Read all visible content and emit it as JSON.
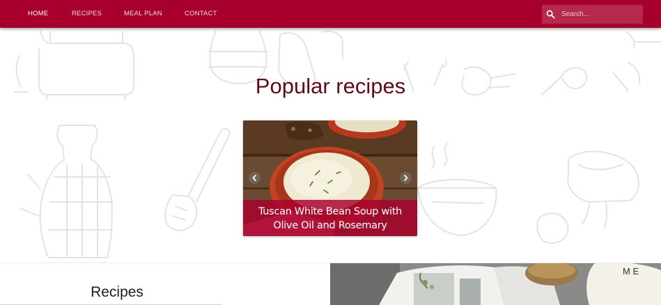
{
  "nav": {
    "links": [
      {
        "label": "HOME",
        "active": true
      },
      {
        "label": "RECIPES",
        "active": false
      },
      {
        "label": "MEAL PLAN",
        "active": false
      },
      {
        "label": "CONTACT",
        "active": false
      }
    ],
    "search": {
      "placeholder": "Search...",
      "value": "",
      "icon": "search-icon"
    }
  },
  "hero": {
    "title": "Popular recipes",
    "carousel": {
      "caption": "Tuscan White Bean Soup with Olive Oil and Rosemary",
      "prev_icon": "chevron-left-icon",
      "next_icon": "chevron-right-icon"
    }
  },
  "sections": {
    "recipes_heading": "Recipes",
    "book_letters": "M E"
  },
  "colors": {
    "brand": "#a8002e",
    "title": "#5e0c1a",
    "doodle_stroke": "#e3e3e3"
  }
}
